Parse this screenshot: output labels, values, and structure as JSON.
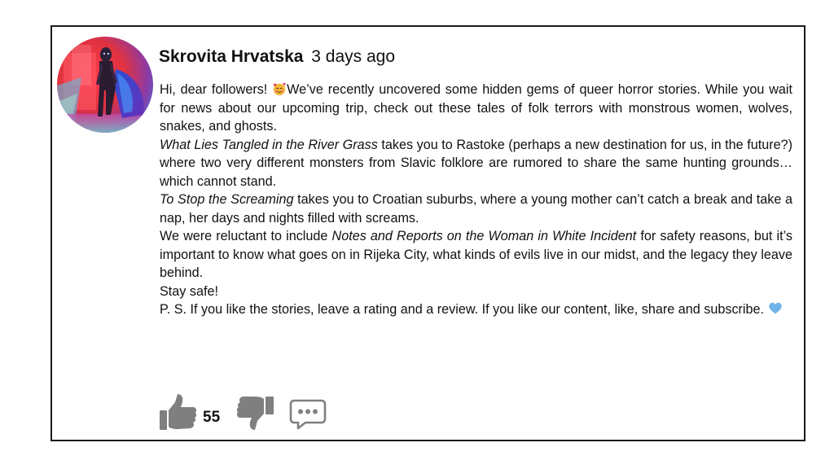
{
  "post": {
    "author": "Skrovita Hrvatska",
    "time": "3 days ago",
    "paragraphs": {
      "p1": {
        "before_emoji": "Hi, dear followers! ",
        "emoji": "smiling-face-with-hearts-icon",
        "after_emoji": "We’ve recently uncovered some hidden gems of queer horror stories. While you wait for news about our upcoming trip, check out these tales of folk terrors with monstrous women, wolves, snakes, and ghosts."
      },
      "p2": {
        "title": "What Lies Tangled in the River Grass",
        "rest": " takes you to Rastoke (perhaps a new destination for us, in the future?) where two very different monsters from Slavic folklore are rumored to share the same hunting grounds… which cannot stand."
      },
      "p3": {
        "title": "To Stop the Screaming",
        "rest": " takes you to Croatian suburbs, where a young mother can’t catch a break and take a nap, her days and nights filled with screams."
      },
      "p4": {
        "before": "We were reluctant to include ",
        "title": "Notes and Reports on the Woman in White Incident",
        "rest": " for safety reasons, but it’s important to know what goes on in Rijeka City, what kinds of evils live in our midst, and the legacy they leave behind."
      },
      "p5": "Stay safe!",
      "p6": {
        "text": "P. S. If you like the stories, leave a rating and a review. If you like our content, like, share and subscribe. ",
        "emoji": "blue-heart-icon"
      }
    }
  },
  "actions": {
    "like_count": "55",
    "like_icon": "thumbs-up-icon",
    "dislike_icon": "thumbs-down-icon",
    "comment_icon": "speech-bubble-icon"
  },
  "colors": {
    "border": "#1a1a1a",
    "icon_gray": "#7f7f7f",
    "heart_blue": "#6fb3e8",
    "emoji_face": "#f4b63a"
  }
}
